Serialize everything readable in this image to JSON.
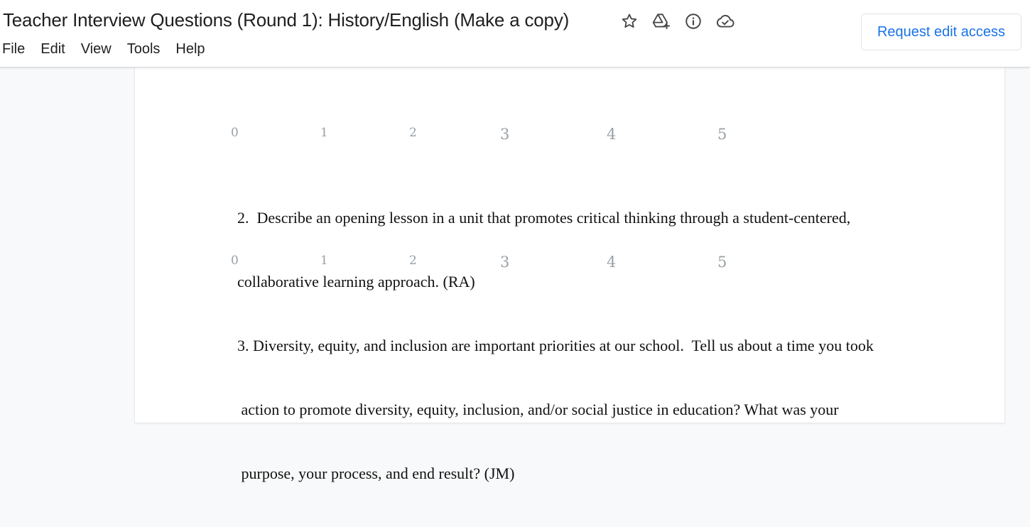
{
  "document": {
    "title": "Teacher Interview Questions (Round 1):  History/English (Make a copy)"
  },
  "title_icons": [
    "star-icon",
    "move-to-drive-icon",
    "info-icon",
    "cloud-saved-icon"
  ],
  "menu": [
    "File",
    "Edit",
    "View",
    "Tools",
    "Help"
  ],
  "actions": {
    "request_edit_access": "Request edit access"
  },
  "colors": {
    "accent": "#1a73e8",
    "scale_text": "#9aa0a6",
    "body_text": "#111111"
  },
  "body": {
    "scale_a": [
      "0",
      "1",
      "2",
      "3",
      "4",
      "5"
    ],
    "question2": {
      "lines": [
        "2.  Describe an opening lesson in a unit that promotes critical thinking through a student-centered,",
        "collaborative learning approach. (RA)"
      ]
    },
    "scale_b": [
      "0",
      "1",
      "2",
      "3",
      "4",
      "5"
    ],
    "question3": {
      "lines": [
        "3. Diversity, equity, and inclusion are important priorities at our school.  Tell us about a time you took",
        " action to promote diversity, equity, inclusion, and/or social justice in education? What was your",
        " purpose, your process, and end result? (JM)"
      ]
    }
  }
}
